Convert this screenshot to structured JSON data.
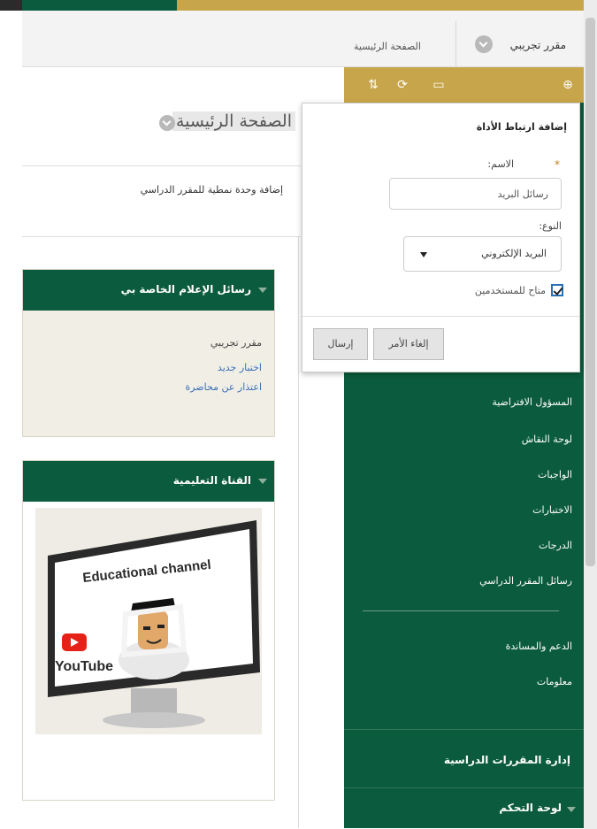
{
  "breadcrumb": {
    "course": "مقرر تجريبي",
    "home": "الصفحة الرئيسية"
  },
  "page": {
    "title": "الصفحة الرئيسية",
    "add_unit": "إضافة وحدة نمطية للمقرر الدراسي"
  },
  "modules": {
    "alerts": {
      "title": "رسائل الإعلام الخاصة بي",
      "course": "مقرر تجريبي",
      "links": [
        "اختبار جديد",
        "اعتذار عن محاضرة"
      ]
    },
    "channel": {
      "title": "القناة التعليمية",
      "video_text": "Educational channel",
      "youtube": "YouTube"
    }
  },
  "tools": {
    "icons": [
      "sort-icon",
      "refresh-icon",
      "folder-icon",
      "add-icon"
    ]
  },
  "sidebar": {
    "items": [
      "المسؤول الافتراضية",
      "لوحة النقاش",
      "الواجبات",
      "الاختبارات",
      "الدرجات",
      "رسائل المقرر الدراسي"
    ],
    "items2": [
      "الدعم والمساندة",
      "معلومات"
    ],
    "section_title": "إدارة المقررات الدراسية",
    "control_panel": "لوحة التحكم"
  },
  "popup": {
    "title": "إضافة ارتباط الأداة",
    "name_label": "الاسم:",
    "name_value": "رسائل البريد",
    "type_label": "النوع:",
    "type_value": "البريد الإلكتروني",
    "checkbox_label": "متاح للمستخدمين",
    "cancel": "إلغاء الأمر",
    "submit": "إرسال"
  },
  "colors": {
    "green": "#0b5b3e",
    "gold": "#c7a54a"
  }
}
